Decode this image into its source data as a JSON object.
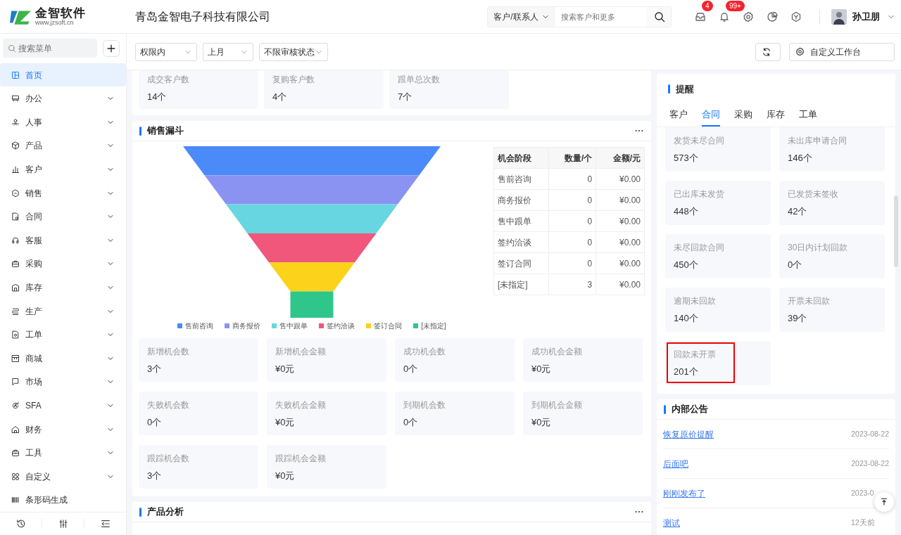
{
  "header": {
    "logo_title": "金智软件",
    "logo_url": "www.jzsoft.cn",
    "company": "青岛金智电子科技有限公司",
    "search_scope": "客户/联系人",
    "search_placeholder": "搜索客户和更多",
    "message_badge": "4",
    "notice_badge": "99+",
    "user_name": "孙卫朋"
  },
  "sidebar": {
    "search_placeholder": "搜索菜单",
    "items": [
      {
        "label": "首页",
        "selected": true,
        "expandable": false
      },
      {
        "label": "办公",
        "selected": false,
        "expandable": true
      },
      {
        "label": "人事",
        "selected": false,
        "expandable": true
      },
      {
        "label": "产品",
        "selected": false,
        "expandable": true
      },
      {
        "label": "客户",
        "selected": false,
        "expandable": true
      },
      {
        "label": "销售",
        "selected": false,
        "expandable": true
      },
      {
        "label": "合同",
        "selected": false,
        "expandable": true
      },
      {
        "label": "客服",
        "selected": false,
        "expandable": true
      },
      {
        "label": "采购",
        "selected": false,
        "expandable": true
      },
      {
        "label": "库存",
        "selected": false,
        "expandable": true
      },
      {
        "label": "生产",
        "selected": false,
        "expandable": true
      },
      {
        "label": "工单",
        "selected": false,
        "expandable": true
      },
      {
        "label": "商城",
        "selected": false,
        "expandable": true
      },
      {
        "label": "市场",
        "selected": false,
        "expandable": true
      },
      {
        "label": "SFA",
        "selected": false,
        "expandable": true
      },
      {
        "label": "财务",
        "selected": false,
        "expandable": true
      },
      {
        "label": "工具",
        "selected": false,
        "expandable": true
      },
      {
        "label": "自定义",
        "selected": false,
        "expandable": true
      },
      {
        "label": "条形码生成",
        "selected": false,
        "expandable": false
      }
    ]
  },
  "filters": [
    {
      "value": "权限内"
    },
    {
      "value": "上月"
    },
    {
      "value": "不限审核状态"
    }
  ],
  "customize_label": "自定义工作台",
  "summary_tiles": [
    {
      "label": "成交客户数",
      "value": "14个"
    },
    {
      "label": "复购客户数",
      "value": "4个"
    },
    {
      "label": "跟单总次数",
      "value": "7个"
    }
  ],
  "funnel": {
    "title": "销售漏斗",
    "table": {
      "columns": [
        "机会阶段",
        "数量/个",
        "金额/元"
      ],
      "rows": [
        [
          "售前咨询",
          "0",
          "¥0.00"
        ],
        [
          "商务报价",
          "0",
          "¥0.00"
        ],
        [
          "售中跟单",
          "0",
          "¥0.00"
        ],
        [
          "签约洽谈",
          "0",
          "¥0.00"
        ],
        [
          "签订合同",
          "0",
          "¥0.00"
        ],
        [
          "[未指定]",
          "3",
          "¥0.00"
        ]
      ]
    },
    "legend": [
      {
        "label": "售前咨询",
        "color": "#4a8af9"
      },
      {
        "label": "商务报价",
        "color": "#8b93f2"
      },
      {
        "label": "售中跟单",
        "color": "#68d6e0"
      },
      {
        "label": "签约洽谈",
        "color": "#f0577a"
      },
      {
        "label": "签订合同",
        "color": "#fcd21a"
      },
      {
        "label": "[未指定]",
        "color": "#2fc68c"
      }
    ],
    "tiles": [
      {
        "label": "新增机会数",
        "value": "3个"
      },
      {
        "label": "新增机会金额",
        "value": "¥0元"
      },
      {
        "label": "成功机会数",
        "value": "0个"
      },
      {
        "label": "成功机会金额",
        "value": "¥0元"
      },
      {
        "label": "失败机会数",
        "value": "0个"
      },
      {
        "label": "失败机会金额",
        "value": "¥0元"
      },
      {
        "label": "到期机会数",
        "value": "0个"
      },
      {
        "label": "到期机会金额",
        "value": "¥0元"
      },
      {
        "label": "跟踪机会数",
        "value": "3个"
      },
      {
        "label": "跟踪机会金额",
        "value": "¥0元"
      }
    ]
  },
  "product_analysis": {
    "title": "产品分析"
  },
  "reminders": {
    "title": "提醒",
    "tabs": [
      {
        "label": "客户",
        "selected": false
      },
      {
        "label": "合同",
        "selected": true
      },
      {
        "label": "采购",
        "selected": false
      },
      {
        "label": "库存",
        "selected": false
      },
      {
        "label": "工单",
        "selected": false
      }
    ],
    "tiles": [
      {
        "label": "发货未尽合同",
        "value": "573个",
        "highlighted": false
      },
      {
        "label": "未出库申请合同",
        "value": "146个",
        "highlighted": false
      },
      {
        "label": "已出库未发货",
        "value": "448个",
        "highlighted": false
      },
      {
        "label": "已发货未签收",
        "value": "42个",
        "highlighted": false
      },
      {
        "label": "未尽回款合同",
        "value": "450个",
        "highlighted": false
      },
      {
        "label": "30日内计划回款",
        "value": "0个",
        "highlighted": false
      },
      {
        "label": "逾期未回款",
        "value": "140个",
        "highlighted": false
      },
      {
        "label": "开票未回款",
        "value": "39个",
        "highlighted": false
      },
      {
        "label": "回款未开票",
        "value": "201个",
        "highlighted": true
      }
    ]
  },
  "notices": {
    "title": "内部公告",
    "items": [
      {
        "title": "恢复原价提醒",
        "date": "2023-08-22"
      },
      {
        "title": "后面吧",
        "date": "2023-08-22"
      },
      {
        "title": "刚刚发布了",
        "date": "2023-0"
      },
      {
        "title": "测试",
        "date": "12天前"
      }
    ]
  }
}
